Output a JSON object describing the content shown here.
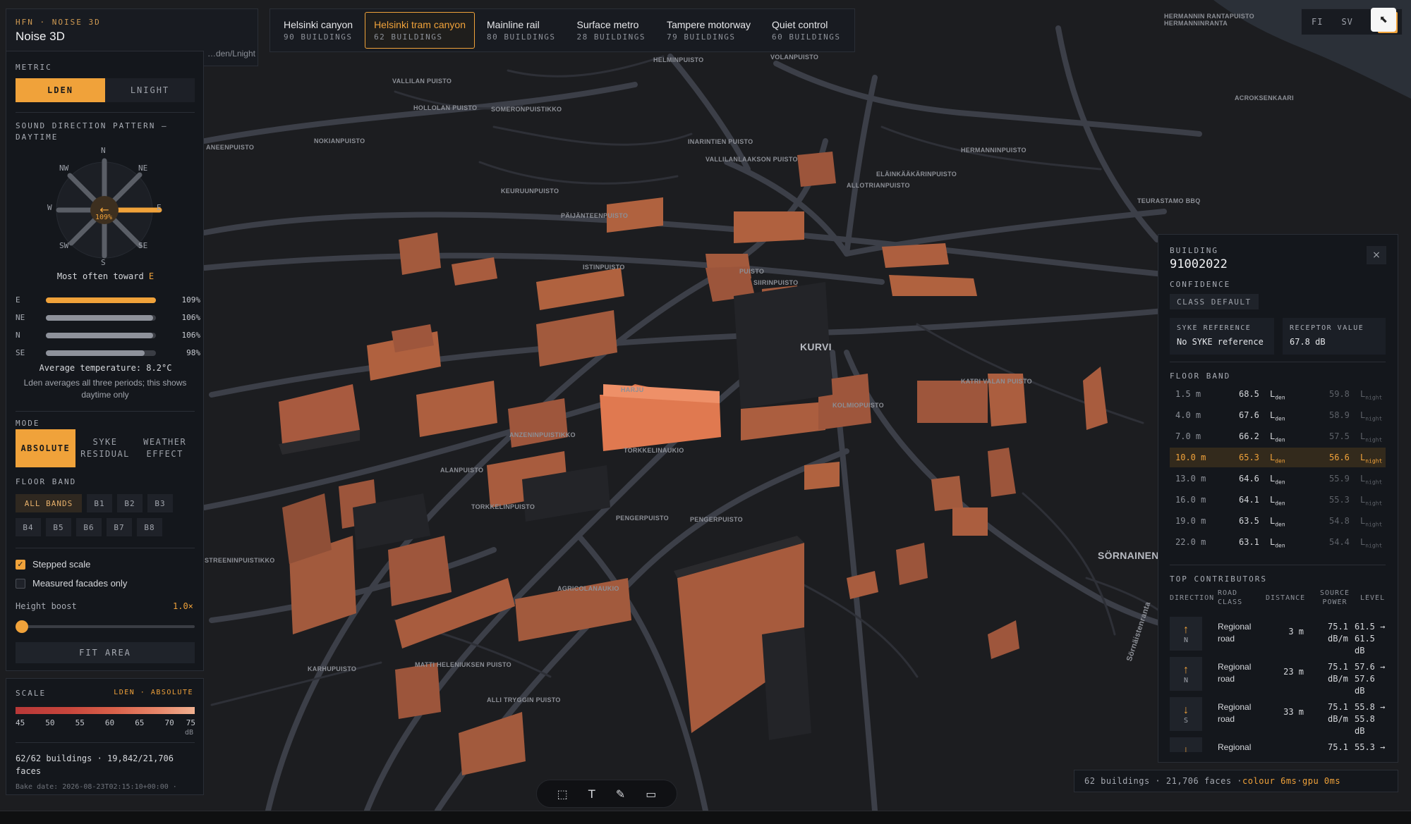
{
  "header": {
    "crumb": "HFN · NOISE 3D",
    "title": "Noise 3D",
    "subtitle": "…den/Lnight"
  },
  "tabs": [
    {
      "name": "Helsinki canyon",
      "count": "90 BUILDINGS",
      "active": false
    },
    {
      "name": "Helsinki tram canyon",
      "count": "62 BUILDINGS",
      "active": true
    },
    {
      "name": "Mainline rail",
      "count": "80 BUILDINGS",
      "active": false
    },
    {
      "name": "Surface metro",
      "count": "28 BUILDINGS",
      "active": false
    },
    {
      "name": "Tampere motorway",
      "count": "79 BUILDINGS",
      "active": false
    },
    {
      "name": "Quiet control",
      "count": "60 BUILDINGS",
      "active": false
    }
  ],
  "lang": {
    "fi": "FI",
    "sv": "SV"
  },
  "metric": {
    "label": "METRIC",
    "options": [
      "LDEN",
      "LNIGHT"
    ],
    "selected": "LDEN"
  },
  "rose": {
    "heading": "SOUND DIRECTION PATTERN — DAYTIME",
    "labels": {
      "n": "N",
      "ne": "NE",
      "e": "E",
      "se": "SE",
      "s": "S",
      "sw": "SW",
      "w": "W",
      "nw": "NW"
    },
    "center_value": "109%",
    "most_often_prefix": "Most often toward",
    "most_often_dir": "E",
    "rows": [
      {
        "dir": "E",
        "pct": "109%",
        "value": 109
      },
      {
        "dir": "NE",
        "pct": "106%",
        "value": 106
      },
      {
        "dir": "N",
        "pct": "106%",
        "value": 106
      },
      {
        "dir": "SE",
        "pct": "98%",
        "value": 98
      }
    ],
    "avg_temp": "Average temperature: 8.2°C",
    "note": "Lden averages all three periods; this shows daytime only"
  },
  "mode": {
    "label": "MODE",
    "options": [
      "ABSOLUTE",
      "SYKE RESIDUAL",
      "WEATHER EFFECT"
    ],
    "selected": "ABSOLUTE"
  },
  "floor_band_filter": {
    "label": "FLOOR BAND",
    "chips": [
      "ALL BANDS",
      "B1",
      "B2",
      "B3",
      "B4",
      "B5",
      "B6",
      "B7",
      "B8"
    ],
    "selected": "ALL BANDS"
  },
  "options": {
    "stepped_scale": {
      "label": "Stepped scale",
      "checked": true
    },
    "measured_only": {
      "label": "Measured facades only",
      "checked": false
    },
    "height_boost": {
      "label": "Height boost",
      "value": "1.0×",
      "level": 0
    }
  },
  "fit_area": "FIT AREA",
  "scale": {
    "label": "SCALE",
    "mode": "LDEN · ABSOLUTE",
    "ticks": [
      "45",
      "50",
      "55",
      "60",
      "65",
      "70",
      "75"
    ],
    "unit": "dB",
    "buildings": "62/62 buildings · 19,842/21,706 faces",
    "bake": "Bake date: 2026-08-23T02:15:10+00:00 ·"
  },
  "building": {
    "label": "BUILDING",
    "id": "91002022",
    "close": "×",
    "confidence_label": "CONFIDENCE",
    "confidence": "CLASS DEFAULT",
    "syke_label": "SYKE REFERENCE",
    "syke_value": "No SYKE reference",
    "receptor_label": "RECEPTOR VALUE",
    "receptor_value": "67.8 dB",
    "floor_band_label": "FLOOR BAND",
    "bands": [
      {
        "h": "1.5 m",
        "lden": "68.5",
        "lnight": "59.8",
        "active": false
      },
      {
        "h": "4.0 m",
        "lden": "67.6",
        "lnight": "58.9",
        "active": false
      },
      {
        "h": "7.0 m",
        "lden": "66.2",
        "lnight": "57.5",
        "active": false
      },
      {
        "h": "10.0 m",
        "lden": "65.3",
        "lnight": "56.6",
        "active": true
      },
      {
        "h": "13.0 m",
        "lden": "64.6",
        "lnight": "55.9",
        "active": false
      },
      {
        "h": "16.0 m",
        "lden": "64.1",
        "lnight": "55.3",
        "active": false
      },
      {
        "h": "19.0 m",
        "lden": "63.5",
        "lnight": "54.8",
        "active": false
      },
      {
        "h": "22.0 m",
        "lden": "63.1",
        "lnight": "54.4",
        "active": false
      }
    ],
    "lden_unit": "L",
    "lden_sub": "den",
    "lnight_sub": "night",
    "contributors_label": "TOP CONTRIBUTORS",
    "cols": {
      "direction": "DIRECTION",
      "road": "ROAD CLASS",
      "distance": "DISTANCE",
      "power": "SOURCE POWER",
      "level": "LEVEL"
    },
    "contributors": [
      {
        "arrow": "↑",
        "dir": "N",
        "road": "Regional road",
        "distance": "3 m",
        "power": "75.1 dB/m",
        "level": "61.5 → 61.5 dB"
      },
      {
        "arrow": "↑",
        "dir": "N",
        "road": "Regional road",
        "distance": "23 m",
        "power": "75.1 dB/m",
        "level": "57.6 → 57.6 dB"
      },
      {
        "arrow": "↓",
        "dir": "S",
        "road": "Regional road",
        "distance": "33 m",
        "power": "75.1 dB/m",
        "level": "55.8 → 55.8 dB"
      },
      {
        "arrow": "↓",
        "dir": "S",
        "road": "Regional",
        "distance": "",
        "power": "75.1",
        "level": "55.3 →"
      }
    ]
  },
  "status": {
    "text": "62 buildings · 21,706 faces · ",
    "colour": "colour 6ms",
    "sep": " · ",
    "gpu": "gpu 0ms"
  },
  "map_labels": [
    "KURVI",
    "SÖRNAINEN",
    "PENGERPUISTO",
    "PENGERPUISTO",
    "TORKKELINPUISTO",
    "ANZENINPUISTIKKO",
    "TORKKELINAUKIO",
    "AGRICOLANAUKIO",
    "KARHUPUISTO",
    "ALLI TRYGGIN PUISTO",
    "MATTI HELENIUKSEN PUISTO",
    "KOLMIOPUISTO",
    "KATRI VALAN PUISTO",
    "TEURASTAMO BBQ",
    "ALLOTRIANPUISTO",
    "HELMINPUISTO",
    "VOLANPUISTO",
    "VALLILAN PUISTO",
    "HOLLOLAN PUISTO",
    "NOKIANPUISTO",
    "KEURUUNPUISTO",
    "PUISTO",
    "ALANPUISTO",
    "STREENINPUISTIKKO",
    "HERMANNINRANTA",
    "ACROKSENKAARI",
    "SOMERONPUISTIKKO",
    "PÄIJÄNTEENPUISTO",
    "Sörnäistenranta",
    "ANEENPUISTO",
    "ELÄINKÄÄKÄRINPUISTO",
    "HERMANNINPUISTO",
    "INARINTIEN PUISTO",
    "VALLILANLAAKSON PUISTO",
    "SIIRINPUISTO",
    "HARJU",
    "HERMANNIN RANTAPUISTO",
    "ISTINPUISTO"
  ]
}
